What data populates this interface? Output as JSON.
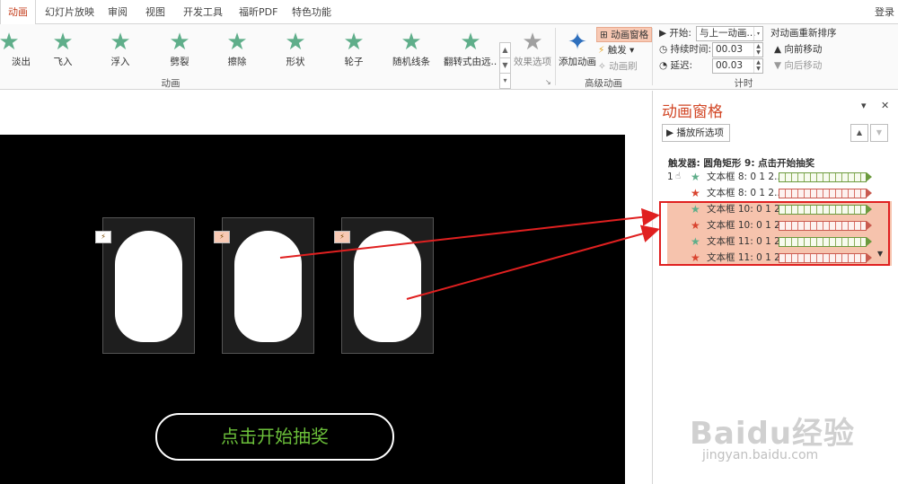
{
  "tabs": [
    "动画",
    "幻灯片放映",
    "审阅",
    "视图",
    "开发工具",
    "福昕PDF",
    "特色功能"
  ],
  "login": "登录",
  "animations": [
    {
      "label": "淡出",
      "icon": "star-icon"
    },
    {
      "label": "飞入",
      "icon": "star-icon"
    },
    {
      "label": "浮入",
      "icon": "star-icon"
    },
    {
      "label": "劈裂",
      "icon": "star-icon"
    },
    {
      "label": "擦除",
      "icon": "star-icon"
    },
    {
      "label": "形状",
      "icon": "star-icon"
    },
    {
      "label": "轮子",
      "icon": "star-icon"
    },
    {
      "label": "随机线条",
      "icon": "star-icon"
    },
    {
      "label": "翻转式由远...",
      "icon": "star-icon"
    }
  ],
  "effect_options": "效果选项",
  "add_animation": "添加动画",
  "animation_pane_btn": "动画窗格",
  "trigger_btn": "触发",
  "anim_brush": "动画刷",
  "groups": {
    "animation": "动画",
    "advanced": "高级动画",
    "timing": "计时"
  },
  "timing": {
    "start_label": "开始:",
    "start_value": "与上一动画...",
    "duration_label": "持续时间:",
    "duration_value": "00.03",
    "delay_label": "延迟:",
    "delay_value": "00.03",
    "reorder_label": "对动画重新排序",
    "move_earlier": "向前移动",
    "move_later": "向后移动"
  },
  "slide": {
    "draw_button": "点击开始抽奖"
  },
  "pane": {
    "title": "动画窗格",
    "play_selected": "播放所选项",
    "trigger_header": "触发器: 圆角矩形 9: 点击开始抽奖",
    "rows": [
      {
        "index": "1",
        "name": "文本框 8: 0 1 2...",
        "color": "green",
        "selected": false
      },
      {
        "index": "",
        "name": "文本框 8: 0 1 2...",
        "color": "red",
        "selected": false
      },
      {
        "index": "",
        "name": "文本框 10: 0 1 2...",
        "color": "green",
        "selected": true
      },
      {
        "index": "",
        "name": "文本框 10: 0 1 2...",
        "color": "red",
        "selected": true
      },
      {
        "index": "",
        "name": "文本框 11: 0 1 2...",
        "color": "green",
        "selected": true
      },
      {
        "index": "",
        "name": "文本框 11: 0 1 2...",
        "color": "red",
        "selected": true
      }
    ]
  },
  "watermark": {
    "logo": "Baidu经验",
    "url": "jingyan.baidu.com"
  },
  "colors": {
    "accent": "#d24726",
    "green_star": "#5fae8a",
    "red_star": "#d9442f",
    "highlight": "#e02020"
  }
}
